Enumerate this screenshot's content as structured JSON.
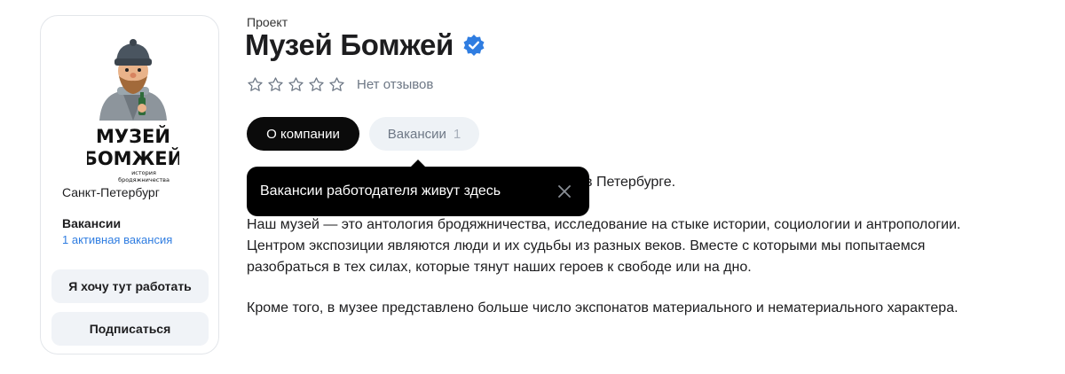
{
  "sidebar": {
    "logo": {
      "line1": "МУЗЕЙ",
      "line2": "БОМЖЕЙ",
      "tagline1": "история",
      "tagline2": "бродяжничества"
    },
    "city": "Санкт-Петербург",
    "vacancies_title": "Вакансии",
    "vacancies_link": "1 активная вакансия",
    "want_work_button": "Я хочу тут работать",
    "subscribe_button": "Подписаться"
  },
  "header": {
    "project_label": "Проект",
    "company_name": "Музей Бомжей",
    "verified_icon": "verified-check-icon",
    "rating_stars": 0,
    "rating_max": 5,
    "reviews_text": "Нет отзывов"
  },
  "tabs": [
    {
      "label": "О компании",
      "active": true
    },
    {
      "label": "Вакансии",
      "count": "1",
      "active": false
    }
  ],
  "description": {
    "p1_visible": "в Петербурге.",
    "p2": "Наш музей — это антология бродяжничества, исследование на стыке истории, социологии и антропологии. Центром экспозиции являются люди и их судьбы из разных веков. Вместе с которыми мы попытаемся разобраться в тех силах, которые тянут наших героев к свободе или на дно.",
    "p3": "Кроме того, в музее представлено больше число экспонатов материального и нематериального характера."
  },
  "tooltip": {
    "text": "Вакансии работодателя живут здесь",
    "close_icon": "close-icon"
  },
  "colors": {
    "accent_blue": "#2f7de1",
    "verified_blue": "#2f7de1",
    "tab_active_bg": "#0b0b0b",
    "tab_inactive_bg": "#eef2f6",
    "button_bg": "#f0f3f7",
    "tooltip_bg": "#000000"
  }
}
